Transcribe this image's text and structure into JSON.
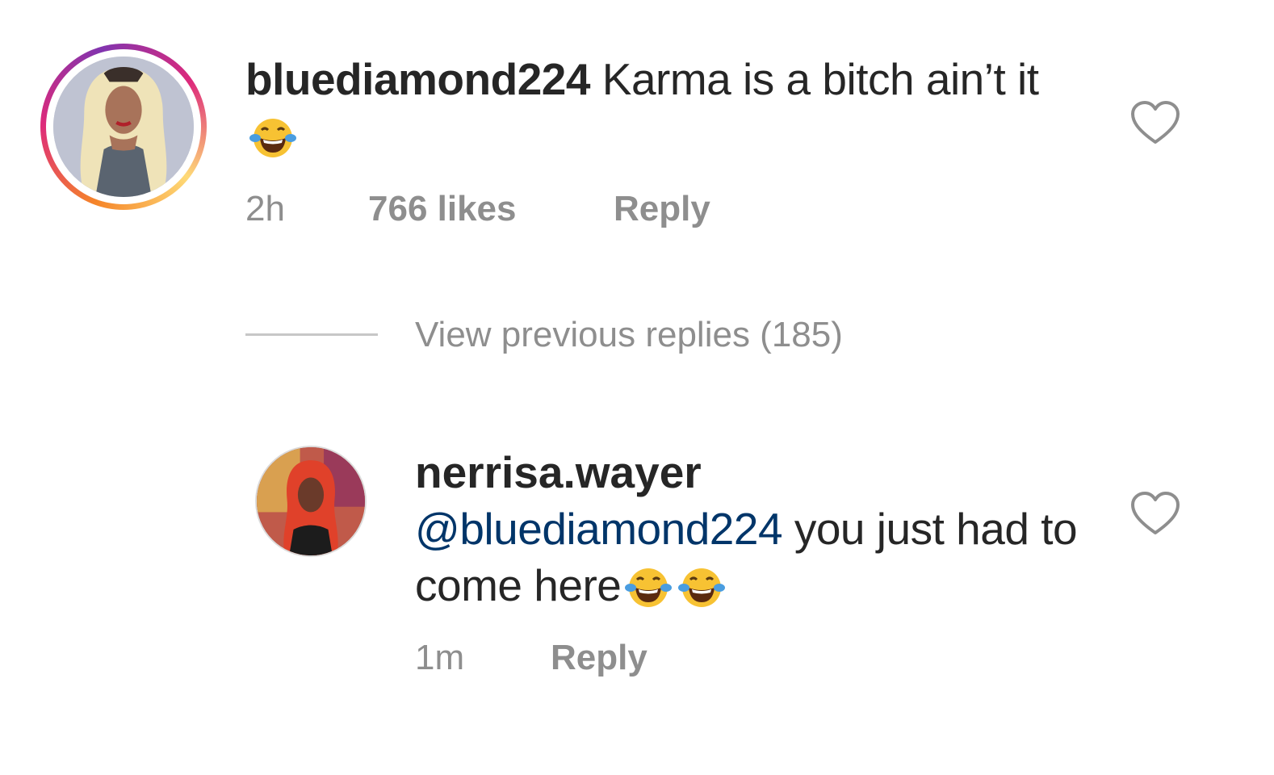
{
  "comment": {
    "username": "bluediamond224",
    "text": "Karma is a bitch ain’t it",
    "emoji_icons": [
      "face-with-tears-of-joy-icon"
    ],
    "time": "2h",
    "likes": "766 likes",
    "reply_label": "Reply",
    "avatar": "profile-photo-blonde-hair",
    "avatar_ring_colors": [
      "#f58529",
      "#dd2a7b",
      "#8134af"
    ]
  },
  "view_replies": {
    "label": "View previous replies (185)"
  },
  "reply": {
    "username": "nerrisa.wayer",
    "mention": "@bluediamond224",
    "text": " you just had to come here",
    "emoji_icons": [
      "face-with-tears-of-joy-icon",
      "face-with-tears-of-joy-icon"
    ],
    "time": "1m",
    "reply_label": "Reply",
    "avatar": "profile-photo-red-hair",
    "mention_color": "#003569"
  },
  "colors": {
    "text": "#262626",
    "muted": "#8e8e8e",
    "divider": "#c7c7c7"
  }
}
